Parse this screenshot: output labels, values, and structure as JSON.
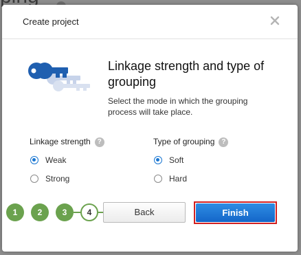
{
  "backdrop": {
    "partial_text": "ping"
  },
  "dialog": {
    "title": "Create project",
    "heading": "Linkage strength and type of grouping",
    "description": "Select the mode in which the grouping process will take place."
  },
  "linkage": {
    "label": "Linkage strength",
    "options": [
      {
        "label": "Weak",
        "selected": true
      },
      {
        "label": "Strong",
        "selected": false
      }
    ]
  },
  "grouping": {
    "label": "Type of grouping",
    "options": [
      {
        "label": "Soft",
        "selected": true
      },
      {
        "label": "Hard",
        "selected": false
      }
    ]
  },
  "wizard": {
    "steps": [
      "1",
      "2",
      "3",
      "4"
    ],
    "current_step": 4
  },
  "buttons": {
    "back": "Back",
    "finish": "Finish"
  },
  "help_glyph": "?",
  "colors": {
    "accent_blue": "#1976d2",
    "step_green": "#6ba24e",
    "finish_outline": "#d32020",
    "key_blue": "#1f5fb0",
    "key_faded": "#c7d3ea"
  },
  "icons": {
    "close": "close-icon",
    "hero": "keys-icon",
    "help": "help-icon"
  }
}
